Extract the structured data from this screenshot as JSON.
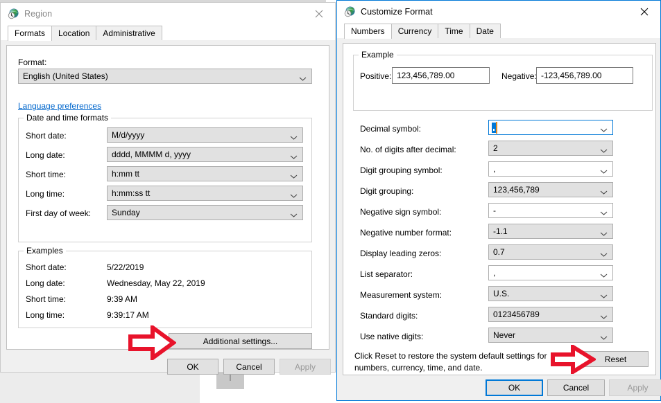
{
  "desktop": {
    "background_color": "#ffffff",
    "left_panel_color": "#ececec"
  },
  "region_window": {
    "title": "Region",
    "icon": "region-globe-clock-icon",
    "active": false,
    "close_label": "✕",
    "tabs": [
      {
        "label": "Formats",
        "selected": true
      },
      {
        "label": "Location",
        "selected": false
      },
      {
        "label": "Administrative",
        "selected": false
      }
    ],
    "format_label": "Format:",
    "format_value": "English (United States)",
    "language_preferences_link": "Language preferences",
    "datetime_group": {
      "title": "Date and time formats",
      "rows": [
        {
          "label": "Short date:",
          "value": "M/d/yyyy"
        },
        {
          "label": "Long date:",
          "value": "dddd, MMMM d, yyyy"
        },
        {
          "label": "Short time:",
          "value": "h:mm tt"
        },
        {
          "label": "Long time:",
          "value": "h:mm:ss tt"
        },
        {
          "label": "First day of week:",
          "value": "Sunday"
        }
      ]
    },
    "examples_group": {
      "title": "Examples",
      "rows": [
        {
          "label": "Short date:",
          "value": "5/22/2019"
        },
        {
          "label": "Long date:",
          "value": "Wednesday, May 22, 2019"
        },
        {
          "label": "Short time:",
          "value": "9:39 AM"
        },
        {
          "label": "Long time:",
          "value": "9:39:17 AM"
        }
      ]
    },
    "additional_settings_button": "Additional settings...",
    "footer": {
      "ok": "OK",
      "cancel": "Cancel",
      "apply": "Apply"
    }
  },
  "customize_window": {
    "title": "Customize Format",
    "icon": "region-globe-clock-icon",
    "active": true,
    "close_label": "✕",
    "tabs": [
      {
        "label": "Numbers",
        "selected": true
      },
      {
        "label": "Currency",
        "selected": false
      },
      {
        "label": "Time",
        "selected": false
      },
      {
        "label": "Date",
        "selected": false
      }
    ],
    "example_group": {
      "title": "Example",
      "positive_label": "Positive:",
      "positive_value": "123,456,789.00",
      "negative_label": "Negative:",
      "negative_value": "-123,456,789.00"
    },
    "settings": [
      {
        "label": "Decimal symbol:",
        "value": ".",
        "state": "focused-selected"
      },
      {
        "label": "No. of digits after decimal:",
        "value": "2",
        "state": "normal"
      },
      {
        "label": "Digit grouping symbol:",
        "value": ",",
        "state": "white"
      },
      {
        "label": "Digit grouping:",
        "value": "123,456,789",
        "state": "normal"
      },
      {
        "label": "Negative sign symbol:",
        "value": "-",
        "state": "white"
      },
      {
        "label": "Negative number format:",
        "value": "-1.1",
        "state": "normal"
      },
      {
        "label": "Display leading zeros:",
        "value": "0.7",
        "state": "normal"
      },
      {
        "label": "List separator:",
        "value": ",",
        "state": "white"
      },
      {
        "label": "Measurement system:",
        "value": "U.S.",
        "state": "normal"
      },
      {
        "label": "Standard digits:",
        "value": "0123456789",
        "state": "normal"
      },
      {
        "label": "Use native digits:",
        "value": "Never",
        "state": "normal"
      }
    ],
    "reset_hint_line1": "Click Reset to restore the system default settings for",
    "reset_hint_line2": "numbers, currency, time, and date.",
    "reset_button": "Reset",
    "footer": {
      "ok": "OK",
      "cancel": "Cancel",
      "apply": "Apply"
    }
  },
  "annotations": [
    {
      "name": "arrow-to-additional-settings",
      "points_to": "Additional settings...",
      "color": "#e8132b"
    },
    {
      "name": "arrow-to-reset",
      "points_to": "Reset",
      "color": "#e8132b"
    }
  ]
}
